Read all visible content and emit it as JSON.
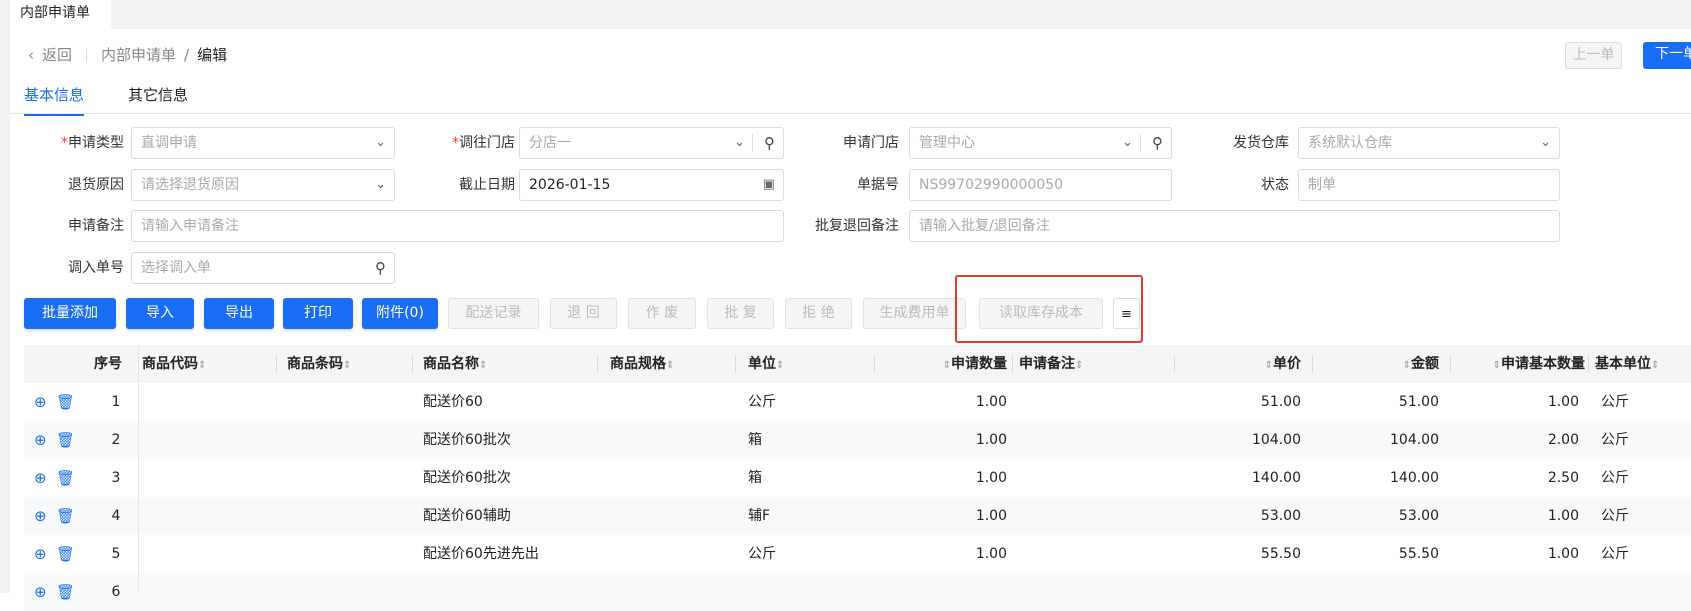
{
  "window_tab": "内部申请单",
  "breadcrumb": {
    "back": "返回",
    "parent": "内部申请单",
    "sep": "/",
    "current": "编辑"
  },
  "nav": {
    "prev": "上一单",
    "next": "下一单"
  },
  "tabs": [
    {
      "label": "基本信息",
      "active": true
    },
    {
      "label": "其它信息",
      "active": false
    }
  ],
  "form": {
    "apply_type": {
      "label": "申请类型",
      "required": true,
      "value": "直调申请"
    },
    "to_store": {
      "label": "调往门店",
      "required": true,
      "value": "分店一"
    },
    "apply_store": {
      "label": "申请门店",
      "value": "管理中心"
    },
    "ship_warehouse": {
      "label": "发货仓库",
      "value": "系统默认仓库"
    },
    "return_reason": {
      "label": "退货原因",
      "placeholder": "请选择退货原因"
    },
    "deadline": {
      "label": "截止日期",
      "value": "2026-01-15"
    },
    "doc_no": {
      "label": "单据号",
      "value": "NS99702990000050"
    },
    "status": {
      "label": "状态",
      "value": "制单"
    },
    "apply_note": {
      "label": "申请备注",
      "placeholder": "请输入申请备注"
    },
    "reply_note": {
      "label": "批复退回备注",
      "placeholder": "请输入批复/退回备注"
    },
    "in_doc": {
      "label": "调入单号",
      "placeholder": "选择调入单"
    }
  },
  "toolbar": [
    "批量添加",
    "导入",
    "导出",
    "打印",
    "附件(0)",
    "配送记录",
    "退 回",
    "作 废",
    "批 复",
    "拒 绝",
    "生成费用单",
    "读取库存成本"
  ],
  "columns": [
    "序号",
    "商品代码",
    "商品条码",
    "商品名称",
    "商品规格",
    "单位",
    "申请数量",
    "申请备注",
    "单价",
    "金额",
    "申请基本数量",
    "基本单位"
  ],
  "rows": [
    {
      "no": "1",
      "name": "配送价60",
      "unit": "公斤",
      "qty": "1.00",
      "price": "51.00",
      "amount": "51.00",
      "base_qty": "1.00",
      "base_unit": "公斤"
    },
    {
      "no": "2",
      "name": "配送价60批次",
      "unit": "箱",
      "qty": "1.00",
      "price": "104.00",
      "amount": "104.00",
      "base_qty": "2.00",
      "base_unit": "公斤"
    },
    {
      "no": "3",
      "name": "配送价60批次",
      "unit": "箱",
      "qty": "1.00",
      "price": "140.00",
      "amount": "140.00",
      "base_qty": "2.50",
      "base_unit": "公斤"
    },
    {
      "no": "4",
      "name": "配送价60辅助",
      "unit": "辅F",
      "qty": "1.00",
      "price": "53.00",
      "amount": "53.00",
      "base_qty": "1.00",
      "base_unit": "公斤"
    },
    {
      "no": "5",
      "name": "配送价60先进先出",
      "unit": "公斤",
      "qty": "1.00",
      "price": "55.50",
      "amount": "55.50",
      "base_qty": "1.00",
      "base_unit": "公斤"
    },
    {
      "no": "6"
    }
  ],
  "colors": {
    "primary": "#1a6ef5",
    "highlight": "#e8392b"
  }
}
